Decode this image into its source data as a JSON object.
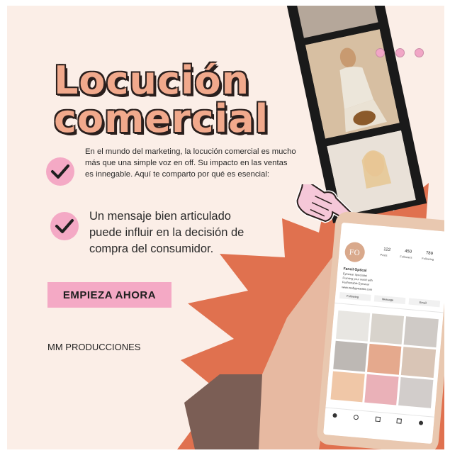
{
  "title": {
    "line1": "Locución",
    "line2": "comercial"
  },
  "intro": "En el mundo del marketing, la locución comercial es mucho más que una simple voz en off. Su impacto en las ventas es innegable. Aquí te comparto por qué es esencial:",
  "point": "Un mensaje bien articulado puede influir en la decisión de compra del consumidor.",
  "cta": {
    "label": "EMPIEZA AHORA"
  },
  "brand": "MM PRODUCCIONES",
  "icons": {
    "check": "check-icon",
    "pointer": "pointing-hand-icon",
    "dots": "dots-decoration"
  },
  "phone": {
    "avatar": "FO",
    "stats": [
      {
        "value": "122",
        "label": "Posts"
      },
      {
        "value": "450",
        "label": "Followers"
      },
      {
        "value": "789",
        "label": "Following"
      }
    ],
    "name": "Faneil Optical",
    "bio": [
      "Eyewear Specialist",
      "Framing your world with",
      "Fashionable Eyewear"
    ],
    "link": "www.reallygreatsite.com",
    "buttons": [
      "Following",
      "Message",
      "Email"
    ]
  },
  "colors": {
    "accent_pink": "#f4a9c5",
    "accent_orange": "#e0714f",
    "title_fill": "#f1a98c",
    "background": "#fbeee7"
  }
}
